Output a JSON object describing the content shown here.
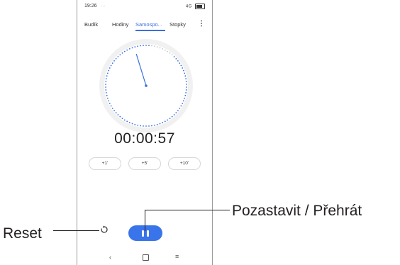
{
  "status_bar": {
    "time": "19:26",
    "dots": "...",
    "signal_icons": "4G"
  },
  "tabs": [
    {
      "label": "Budík"
    },
    {
      "label": "Hodiny"
    },
    {
      "label": "Samospo..."
    },
    {
      "label": "Stopky"
    }
  ],
  "active_tab": "Samospo...",
  "colors": {
    "accent": "#3a6fe0",
    "button": "#3a74ea"
  },
  "timer": {
    "display": "00:00:57",
    "progress_fraction": 0.05
  },
  "add_buttons": [
    {
      "label": "+1'"
    },
    {
      "label": "+5'"
    },
    {
      "label": "+10'"
    }
  ],
  "controls": {
    "reset_icon": "reset-icon",
    "pause_icon": "pause-icon"
  },
  "nav": {
    "back_icon": "back-icon",
    "home_icon": "home-icon",
    "recents_icon": "menu-icon"
  },
  "callouts": {
    "reset_label": "Reset",
    "pause_label": "Pozastavit / Přehrát"
  }
}
